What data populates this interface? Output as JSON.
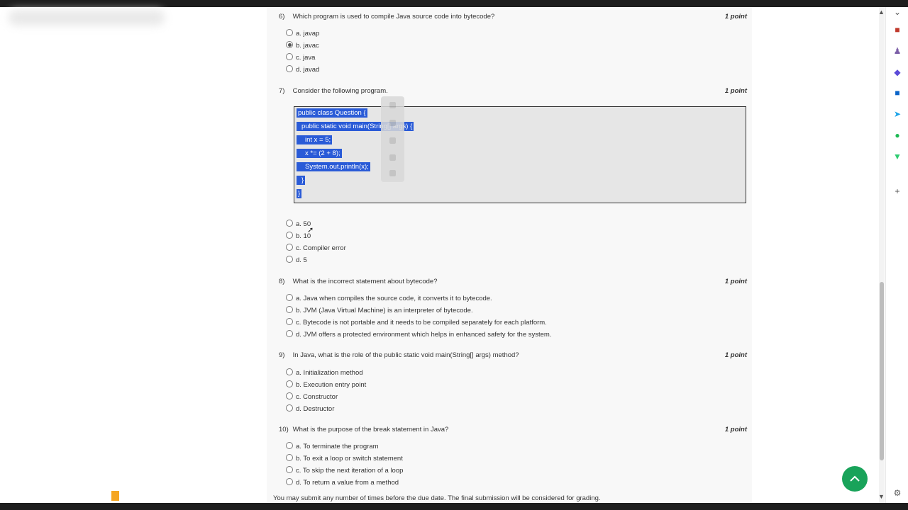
{
  "questions": [
    {
      "number": "6)",
      "text": "Which program is used to compile Java source code into bytecode?",
      "point": "1 point",
      "options": [
        "a. javap",
        "b. javac",
        "c. java",
        "d. javad"
      ],
      "selected": 1
    },
    {
      "number": "7)",
      "text": "Consider the following program.",
      "point": "1 point",
      "code": [
        "public class Question {",
        "public static void main(String[] args) {",
        "int x = 5;",
        "x *= (2 + 8);",
        "System.out.println(x);",
        "}",
        "}"
      ],
      "options": [
        "a. 50",
        "b. 10",
        "c. Compiler error",
        "d. 5"
      ]
    },
    {
      "number": "8)",
      "text": "What is the incorrect statement about bytecode?",
      "point": "1 point",
      "options": [
        "a. Java when compiles the source code, it converts it to bytecode.",
        "b. JVM (Java Virtual Machine) is an interpreter of bytecode.",
        "c. Bytecode is not portable and it needs to be compiled separately for each platform.",
        "d. JVM offers a protected environment which helps in enhanced safety for the system."
      ]
    },
    {
      "number": "9)",
      "text": "In Java, what is the role of the public static void main(String[] args) method?",
      "point": "1 point",
      "options": [
        "a. Initialization method",
        "b. Execution entry point",
        "c. Constructor",
        "d. Destructor"
      ]
    },
    {
      "number": "10)",
      "text": "What is the purpose of the break statement in Java?",
      "point": "1 point",
      "options": [
        "a. To terminate the program",
        "b. To exit a loop or switch statement",
        "c. To skip the next iteration of a loop",
        "d. To return a value from a method"
      ]
    }
  ],
  "footer_note": "You may submit any number of times before the due date. The final submission will be considered for grading.",
  "colors": {
    "selection": "#2a5bd7",
    "fab": "#19a35a"
  },
  "sidebar_icons": [
    "briefcase-icon",
    "person-icon",
    "copilot-icon",
    "outlook-icon",
    "send-icon",
    "spotify-icon",
    "trophy-icon",
    "add-icon",
    "settings-icon"
  ]
}
